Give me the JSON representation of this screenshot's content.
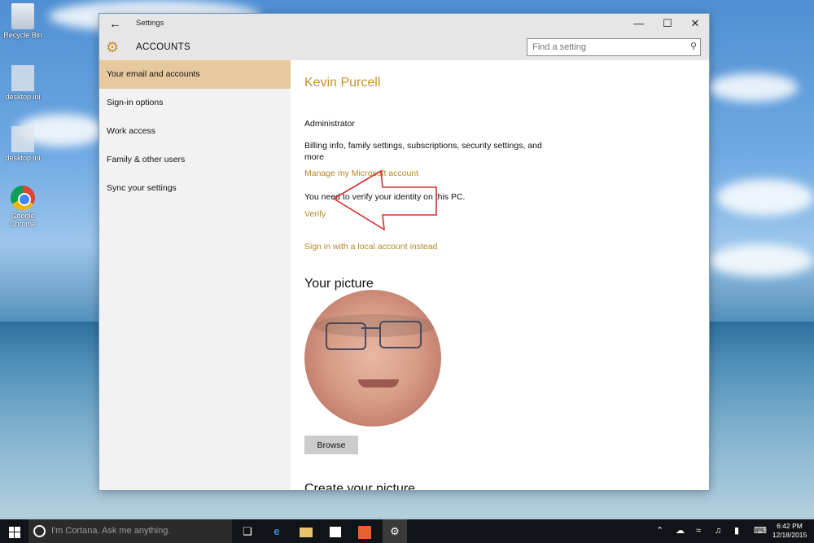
{
  "desktop": {
    "icons": [
      {
        "label": "Recycle Bin",
        "icon": "recycle-bin-icon"
      },
      {
        "label": "desktop.ini",
        "icon": "file-icon"
      },
      {
        "label": "desktop.ini",
        "icon": "file-icon"
      },
      {
        "label": "Google Chrome",
        "icon": "chrome-icon"
      }
    ]
  },
  "window": {
    "title": "Settings",
    "section_title": "ACCOUNTS",
    "search_placeholder": "Find a setting",
    "controls": {
      "minimize": "—",
      "maximize": "☐",
      "close": "✕"
    }
  },
  "sidebar": {
    "items": [
      {
        "label": "Your email and accounts",
        "active": true
      },
      {
        "label": "Sign-in options",
        "active": false
      },
      {
        "label": "Work access",
        "active": false
      },
      {
        "label": "Family & other users",
        "active": false
      },
      {
        "label": "Sync your settings",
        "active": false
      }
    ]
  },
  "account": {
    "name": "Kevin Purcell",
    "role": "Administrator",
    "billing_text": "Billing info, family settings, subscriptions, security settings, and more",
    "manage_link": "Manage my Microsoft account",
    "verify_text": "You need to verify your identity on this PC.",
    "verify_link": "Verify",
    "local_link": "Sign in with a local account instead"
  },
  "picture": {
    "heading": "Your picture",
    "browse_label": "Browse",
    "next_heading": "Create your picture"
  },
  "taskbar": {
    "cortana_placeholder": "I'm Cortana. Ask me anything.",
    "clock_time": "6:42 PM",
    "clock_date": "12/18/2015"
  },
  "colors": {
    "accent": "#c8902c",
    "active_bg": "#e7c9a0",
    "arrow": "#d43030"
  }
}
